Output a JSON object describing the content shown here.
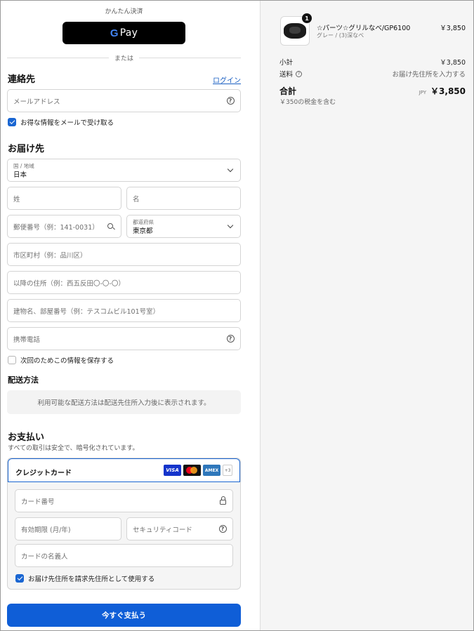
{
  "express": {
    "label": "かんたん決済",
    "gpay_label": "Pay"
  },
  "divider_text": "または",
  "contact": {
    "heading": "連絡先",
    "login_link": "ログイン",
    "email_placeholder": "メールアドレス",
    "newsletter_label": "お得な情報をメールで受け取る"
  },
  "delivery": {
    "heading": "お届け先",
    "country_label": "国 / 地域",
    "country_value": "日本",
    "last_name_placeholder": "姓",
    "first_name_placeholder": "名",
    "postal_placeholder": "郵便番号（例：141-0031）",
    "prefecture_label": "都道府県",
    "prefecture_value": "東京都",
    "city_placeholder": "市区町村（例：品川区）",
    "address_placeholder": "以降の住所（例：西五反田〇-〇-〇）",
    "building_placeholder": "建物名、部屋番号（例：テスコムビル101号室）",
    "phone_placeholder": "携帯電話",
    "save_info_label": "次回のためこの情報を保存する"
  },
  "shipping": {
    "heading": "配送方法",
    "notice": "利用可能な配送方法は配送先住所入力後に表示されます。"
  },
  "payment": {
    "heading": "お支払い",
    "subtitle": "すべての取引は安全で、暗号化されています。",
    "method_label": "クレジットカード",
    "logos": [
      "VISA",
      "Mastercard",
      "AMEX",
      "+3"
    ],
    "card_number_placeholder": "カード番号",
    "expiry_placeholder": "有効期限 (月/年)",
    "cvc_placeholder": "セキュリティコード",
    "name_placeholder": "カードの名義人",
    "billing_same_label": "お届け先住所を請求先住所として使用する",
    "pay_button": "今すぐ支払う"
  },
  "summary": {
    "item": {
      "quantity": "1",
      "name": "☆パーツ☆グリルなべ/GP6100",
      "variant": "グレー / (3)深なべ",
      "price": "￥3,850"
    },
    "subtotal_label": "小計",
    "subtotal_value": "￥3,850",
    "shipping_label": "送料",
    "shipping_value": "お届け先住所を入力する",
    "total_label": "合計",
    "total_currency": "JPY",
    "total_value": "￥3,850",
    "tax_note": "￥350の税金を含む"
  },
  "colors": {
    "accent": "#0f5ed7",
    "checkbox": "#1a66d2",
    "link": "#1a5fc2"
  }
}
